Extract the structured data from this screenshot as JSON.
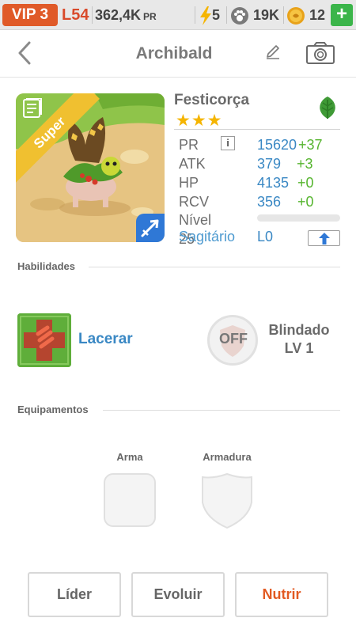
{
  "status_bar": {
    "vip": "VIP 3",
    "level": "L54",
    "power": "362,4K",
    "power_unit": "PR",
    "energy": "5",
    "food": "19K",
    "coins": "12",
    "add_label": "+"
  },
  "nav": {
    "title": "Archibald"
  },
  "monster": {
    "name": "Festicorça",
    "stars": "★★★",
    "rarity_badge": "Super",
    "element_icon": "leaf-icon",
    "info_label": "i",
    "stats": [
      {
        "label": "PR",
        "value": "15620",
        "bonus": "+37"
      },
      {
        "label": "ATK",
        "value": "379",
        "bonus": "+3"
      },
      {
        "label": "HP",
        "value": "4135",
        "bonus": "+0"
      },
      {
        "label": "RCV",
        "value": "356",
        "bonus": "+0"
      }
    ],
    "level_label": "Nível 25",
    "level_progress": 0,
    "constellation": "Sagitário",
    "constellation_level": "L0"
  },
  "skills": {
    "header": "Habilidades",
    "primary": {
      "label": "Lacerar"
    },
    "secondary": {
      "badge": "OFF",
      "name": "Blindado",
      "level": "LV 1"
    }
  },
  "equipment": {
    "header": "Equipamentos",
    "weapon_label": "Arma",
    "armor_label": "Armadura"
  },
  "actions": {
    "leader": "Líder",
    "evolve": "Evoluir",
    "feed": "Nutrir"
  },
  "colors": {
    "accent_blue": "#3a88c4",
    "bonus_green": "#56b52f",
    "feed_orange": "#e25a22",
    "vip_orange": "#e05a28"
  }
}
